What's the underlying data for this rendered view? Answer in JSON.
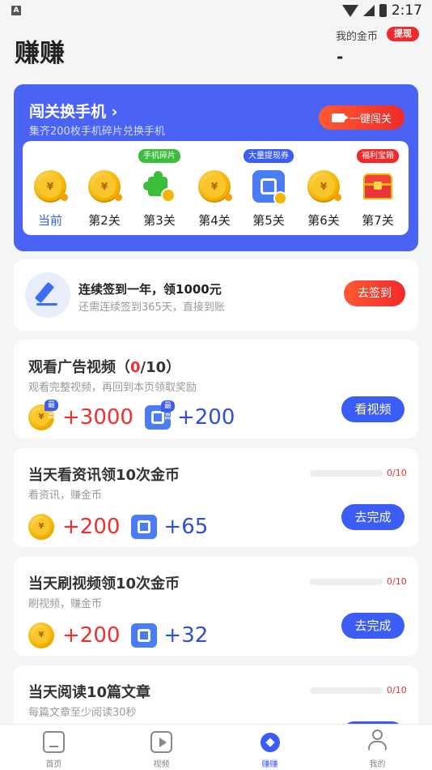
{
  "status": {
    "time": "2:17"
  },
  "header": {
    "title": "赚赚",
    "coins_label": "我的金币",
    "withdraw_label": "提现",
    "coins_value": "-"
  },
  "level_card": {
    "title": "闯关换手机",
    "subtitle": "集齐200枚手机碎片兑换手机",
    "button_label": "一键闯关",
    "levels": [
      {
        "label": "当前",
        "icon": "coin-icon",
        "tag": ""
      },
      {
        "label": "第2关",
        "icon": "coin-icon",
        "tag": ""
      },
      {
        "label": "第3关",
        "icon": "puzzle-icon",
        "tag": "手机碎片"
      },
      {
        "label": "第4关",
        "icon": "coin-icon",
        "tag": ""
      },
      {
        "label": "第5关",
        "icon": "ticket-icon",
        "tag": "大量提现券"
      },
      {
        "label": "第6关",
        "icon": "coin-icon",
        "tag": ""
      },
      {
        "label": "第7关",
        "icon": "chest-icon",
        "tag": "福利宝箱"
      }
    ],
    "tag_colors": {
      "手机碎片": "#3bbf3b",
      "大量提现券": "#3b5cf5",
      "福利宝箱": "#f02a2a"
    }
  },
  "signin": {
    "title": "连续签到一年，领1000元",
    "subtitle": "还需连续签到365天，直接到账",
    "button_label": "去签到"
  },
  "tasks": [
    {
      "title_prefix": "观看广告视频（",
      "title_count": "0",
      "title_suffix": "/10）",
      "subtitle": "观看完整视频，再回到本页领取奖励",
      "coin_reward": "+3000",
      "ticket_reward": "+200",
      "coin_tag": "最高",
      "ticket_tag": "最高",
      "button_label": "看视频"
    },
    {
      "title": "当天看资讯领10次金币",
      "subtitle": "看资讯，赚金币",
      "coin_reward": "+200",
      "ticket_reward": "+65",
      "progress_text": "0/10",
      "progress_fraction": 0,
      "button_label": "去完成"
    },
    {
      "title": "当天刷视频领10次金币",
      "subtitle": "刷视频，赚金币",
      "coin_reward": "+200",
      "ticket_reward": "+32",
      "progress_text": "0/10",
      "progress_fraction": 0,
      "button_label": "去完成"
    },
    {
      "title": "当天阅读10篇文章",
      "subtitle": "每篇文章至少阅读30秒",
      "progress_text": "0/10",
      "progress_fraction": 0
    }
  ],
  "coin_symbol": "¥",
  "tabbar": [
    {
      "label": "首页",
      "icon": "home-icon",
      "active": false
    },
    {
      "label": "视频",
      "icon": "video-icon",
      "active": false
    },
    {
      "label": "赚赚",
      "icon": "earn-icon",
      "active": true
    },
    {
      "label": "我的",
      "icon": "profile-icon",
      "active": false
    }
  ]
}
